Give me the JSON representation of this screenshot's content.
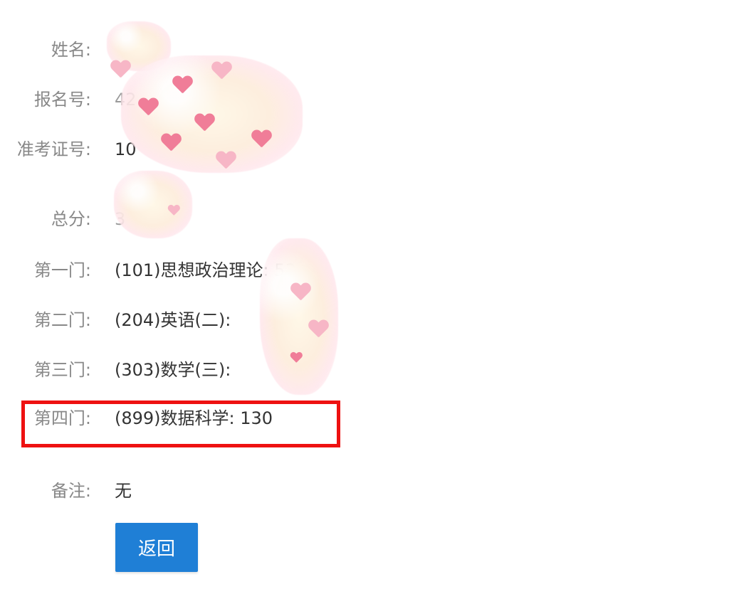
{
  "fields": {
    "name": {
      "label": "姓名:",
      "value": ""
    },
    "registration_no": {
      "label": "报名号:",
      "value": "42"
    },
    "admission_no": {
      "label": "准考证号:",
      "value": "10"
    },
    "total": {
      "label": "总分:",
      "value": "3"
    },
    "subject1": {
      "label": "第一门:",
      "value": "(101)思想政治理论: 53"
    },
    "subject2": {
      "label": "第二门:",
      "value": "(204)英语(二):"
    },
    "subject3": {
      "label": "第三门:",
      "value": "(303)数学(三):"
    },
    "subject4": {
      "label": "第四门:",
      "value": "(899)数据科学: 130"
    },
    "remarks": {
      "label": "备注:",
      "value": "无"
    }
  },
  "back_button": {
    "label": "返回"
  },
  "colors": {
    "label": "#888888",
    "value": "#333333",
    "button": "#1f7fd6",
    "highlight_border": "#ee1111",
    "sticker_heart": "#f07d98"
  },
  "icons": [
    "heart-icon"
  ]
}
